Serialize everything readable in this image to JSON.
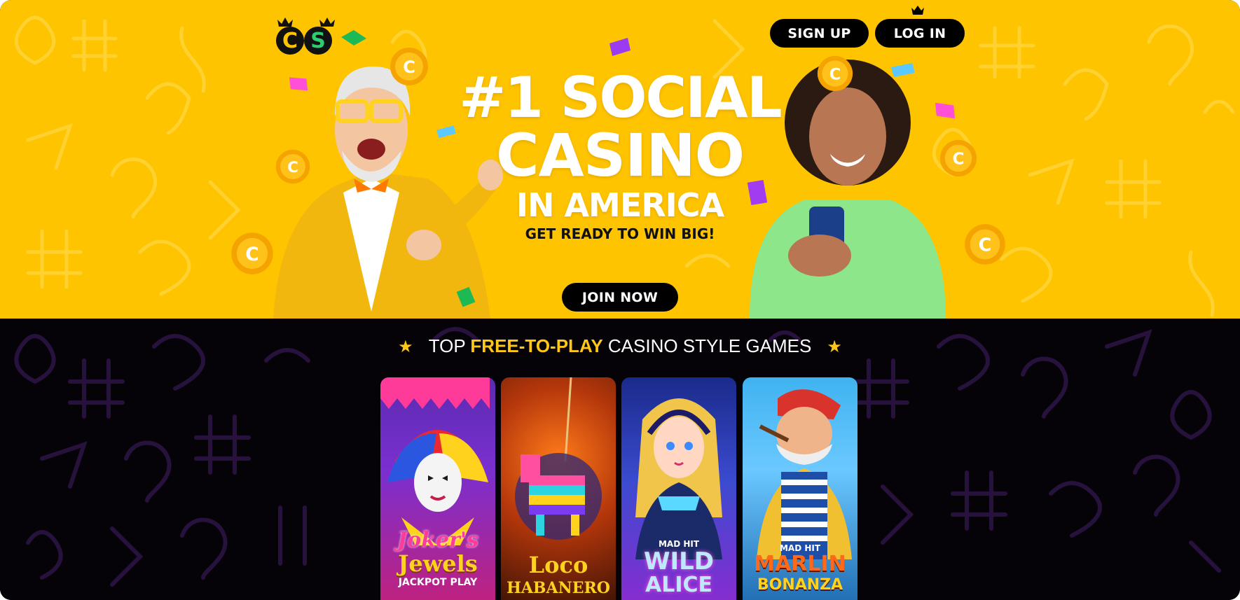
{
  "header": {
    "logo_text": "CS",
    "signup_label": "SIGN UP",
    "login_label": "LOG IN"
  },
  "hero": {
    "headline_line1": "#1 SOCIAL",
    "headline_line2": "CASINO",
    "headline_line3": "IN AMERICA",
    "tagline": "GET READY TO WIN BIG!",
    "cta_label": "JOIN NOW"
  },
  "games_section": {
    "title_prefix": "TOP ",
    "title_highlight": "FREE-TO-PLAY",
    "title_suffix": " CASINO STYLE GAMES",
    "cards": [
      {
        "title_line1": "Joker's",
        "title_line2": "Jewels",
        "subtitle": "JACKPOT PLAY"
      },
      {
        "title_line1": "Loco",
        "title_line2": "HABANERO",
        "subtitle": ""
      },
      {
        "brand": "MAD HIT",
        "title_line1": "WILD",
        "title_line2": "ALICE"
      },
      {
        "brand": "MAD HIT",
        "title_line1": "MARLIN",
        "title_line2": "BONANZA"
      }
    ]
  },
  "colors": {
    "hero_bg": "#ffc400",
    "dark_bg": "#050308",
    "accent": "#ffc61a",
    "button_bg": "#000000",
    "button_text": "#ffffff"
  },
  "icons": [
    "crown-icon",
    "star-icon",
    "coin-icon",
    "confetti-icon"
  ]
}
